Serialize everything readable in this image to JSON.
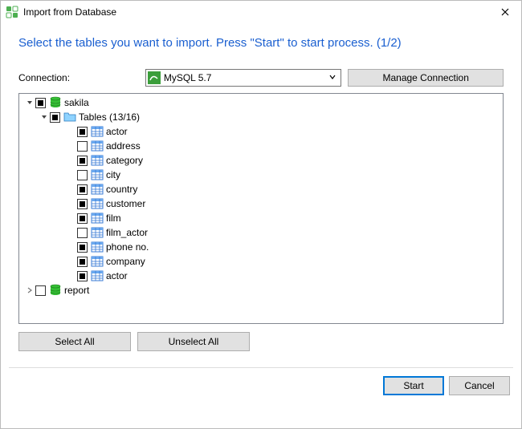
{
  "window": {
    "title": "Import from Database"
  },
  "instruction": "Select the tables you want to import. Press \"Start\" to start process. (1/2)",
  "connection": {
    "label": "Connection:",
    "selected": "MySQL 5.7",
    "manage_button": "Manage Connection"
  },
  "tree": {
    "root": {
      "name": "sakila",
      "checked": true,
      "expanded": true,
      "tables_group": {
        "label": "Tables (13/16)",
        "checked": true,
        "expanded": true,
        "items": [
          {
            "name": "actor",
            "checked": true
          },
          {
            "name": "address",
            "checked": false
          },
          {
            "name": "category",
            "checked": true
          },
          {
            "name": "city",
            "checked": false
          },
          {
            "name": "country",
            "checked": true
          },
          {
            "name": "customer",
            "checked": true
          },
          {
            "name": "film",
            "checked": true
          },
          {
            "name": "film_actor",
            "checked": false
          },
          {
            "name": "phone no.",
            "checked": true
          },
          {
            "name": "company",
            "checked": true
          },
          {
            "name": "actor",
            "checked": true
          }
        ]
      }
    },
    "sibling": {
      "name": "report",
      "checked": false,
      "expanded": false
    }
  },
  "buttons": {
    "select_all": "Select All",
    "unselect_all": "Unselect All",
    "start": "Start",
    "cancel": "Cancel"
  }
}
